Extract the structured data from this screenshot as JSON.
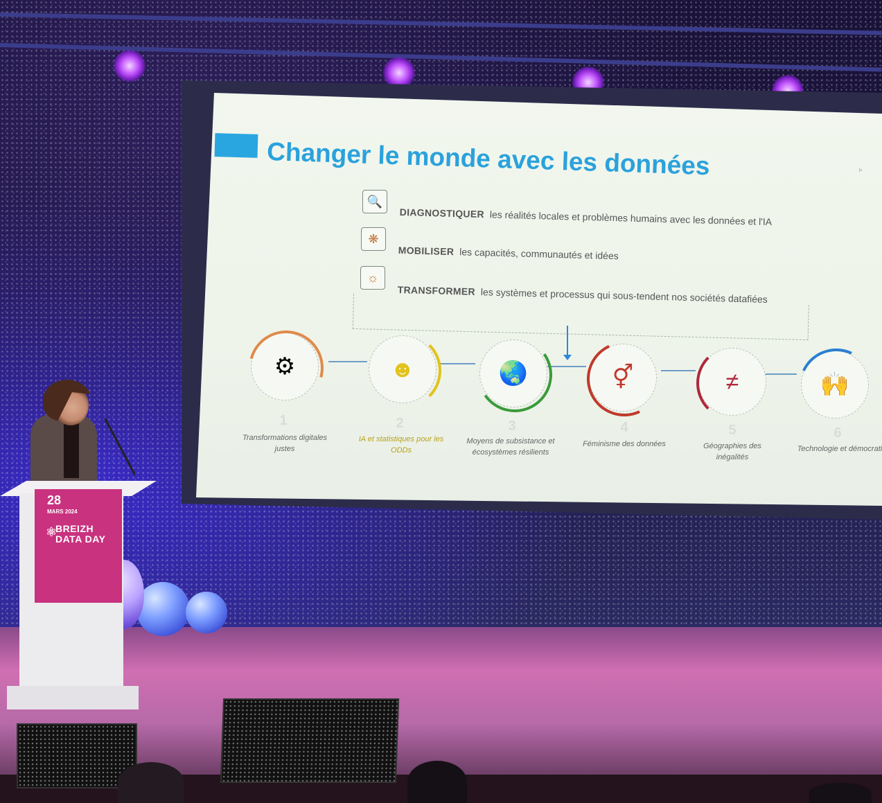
{
  "slide": {
    "title": "Changer le monde avec les données",
    "bullets": [
      {
        "keyword": "DIAGNOSTIQUER",
        "text": "les réalités locales et problèmes humains avec les données et l'IA",
        "icon": "magnifier-person-icon"
      },
      {
        "keyword": "MOBILISER",
        "text": "les capacités, communautés et idées",
        "icon": "network-icon"
      },
      {
        "keyword": "TRANSFORMER",
        "text": "les systèmes et processus qui sous-tendent nos sociétés datafiées",
        "icon": "sun-gear-icon"
      }
    ],
    "themes": [
      {
        "number": "1",
        "caption": "Transformations digitales justes",
        "icon": "gear-person-icon",
        "accent": "#e08a4c"
      },
      {
        "number": "2",
        "caption": "IA et statistiques pour les ODDs",
        "icon": "ai-head-icon",
        "accent": "#e2c21c"
      },
      {
        "number": "3",
        "caption": "Moyens de subsistance et écosystèmes résilients",
        "icon": "earth-leaf-icon",
        "accent": "#3a9a3a"
      },
      {
        "number": "4",
        "caption": "Féminisme des données",
        "icon": "gender-equality-icon",
        "accent": "#c0392b"
      },
      {
        "number": "5",
        "caption": "Géographies des inégalités",
        "icon": "not-equal-icon",
        "accent": "#b0283c"
      },
      {
        "number": "6",
        "caption": "Technologie et démocratie",
        "icon": "raised-hands-icon",
        "accent": "#2a7fd0"
      }
    ]
  },
  "podium": {
    "date": "28",
    "month_year": "MARS 2024",
    "brand": "BREIZH DATA DAY"
  },
  "colors": {
    "title_blue": "#2aa2dc",
    "banner_magenta": "#c8327f",
    "stage_purple": "#c75cff"
  }
}
